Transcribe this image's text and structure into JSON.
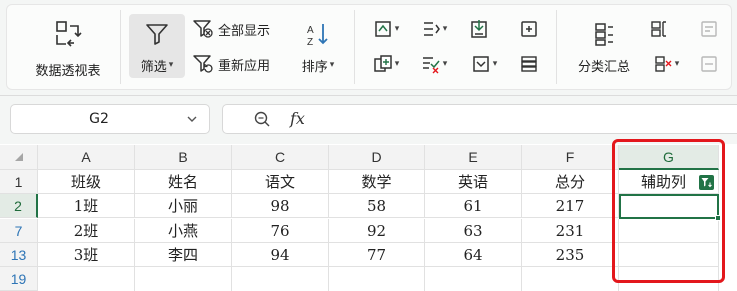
{
  "ribbon": {
    "pivot_label": "数据透视表",
    "filter_label": "筛选",
    "show_all_label": "全部显示",
    "reapply_label": "重新应用",
    "sort_label": "排序",
    "subtotal_label": "分类汇总",
    "icons": [
      "pivot-table-icon",
      "filter-funnel-icon",
      "clear-filter-icon",
      "reapply-filter-icon",
      "sort-az-icon",
      "fill-icon",
      "text-to-columns-icon",
      "validity-icon",
      "remove-duplicates-icon",
      "consolidate-icon",
      "insert-cells-icon",
      "delete-cells-icon",
      "group-icon",
      "ungroup-icon",
      "subtotal-icon",
      "show-detail-icon",
      "hide-detail-icon"
    ],
    "accent": "#217346"
  },
  "formula_bar": {
    "name_box": "G2",
    "zoom_icon": "search-icon",
    "fx_label": "fx",
    "formula": ""
  },
  "grid": {
    "columns": [
      "A",
      "B",
      "C",
      "D",
      "E",
      "F",
      "G"
    ],
    "selected_column": "G",
    "rows": [
      {
        "num": "1",
        "cells": [
          "班级",
          "姓名",
          "语文",
          "数学",
          "英语",
          "总分",
          "辅助列"
        ]
      },
      {
        "num": "2",
        "cells": [
          "1班",
          "小丽",
          "98",
          "58",
          "61",
          "217",
          ""
        ]
      },
      {
        "num": "7",
        "cells": [
          "2班",
          "小燕",
          "76",
          "92",
          "63",
          "231",
          ""
        ]
      },
      {
        "num": "13",
        "cells": [
          "3班",
          "李四",
          "94",
          "77",
          "64",
          "235",
          ""
        ]
      },
      {
        "num": "19",
        "cells": [
          "",
          "",
          "",
          "",
          "",
          "",
          ""
        ]
      }
    ],
    "active_cell": "G2",
    "highlight_color": "#e3171c"
  }
}
